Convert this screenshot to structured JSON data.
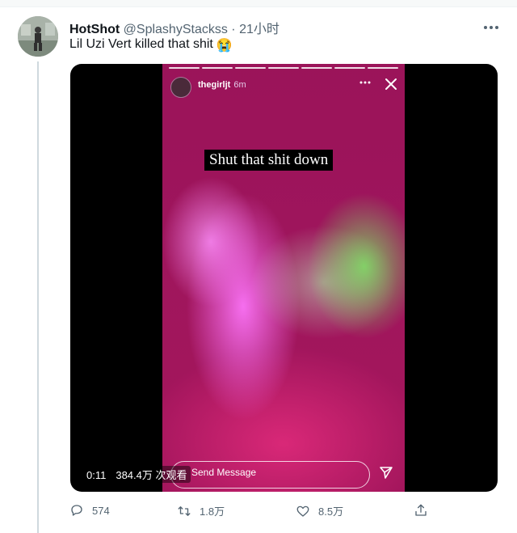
{
  "tweet": {
    "author_name": "HotShot",
    "author_handle": "@SplashyStackss",
    "separator": "·",
    "time": "21小时",
    "text": "Lil Uzi Vert killed that shit",
    "emoji": "😭",
    "more_icon": "more-horizontal-icon"
  },
  "video": {
    "story_user": "thegirljt",
    "story_time": "6m",
    "caption": "Shut that shit down",
    "message_placeholder": "Send Message",
    "elapsed": "0:11",
    "views": "384.4万 次观看"
  },
  "actions": {
    "reply_count": "574",
    "retweet_count": "1.8万",
    "like_count": "8.5万"
  },
  "colors": {
    "secondary_text": "#536471",
    "thread_line": "#cfd9de",
    "primary_text": "#0f1419"
  }
}
